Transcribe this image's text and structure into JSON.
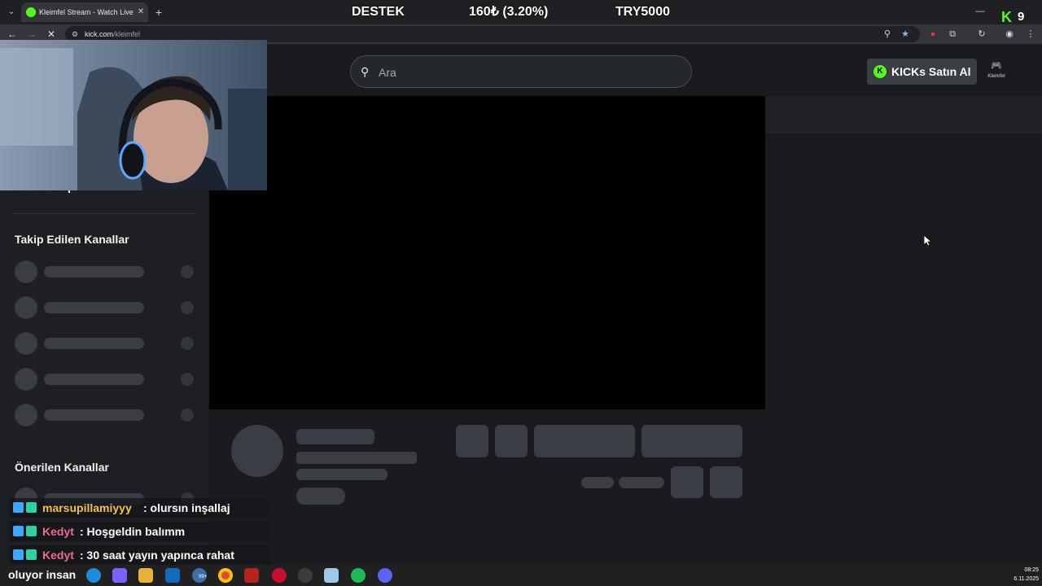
{
  "browser": {
    "tab": {
      "title": "Kleimfel Stream - Watch Live o",
      "close": "✕"
    },
    "new_tab": "+",
    "dropdown": "⌄",
    "url": {
      "host": "kick.com",
      "path": "/kleimfel"
    },
    "minimize": "—",
    "kick_badge": {
      "letter": "K",
      "count": "9"
    }
  },
  "stream_overlay": {
    "label": "DESTEK",
    "amount": "160₺ (3.20%)",
    "goal": "TRY5000"
  },
  "header": {
    "search_placeholder": "Ara",
    "kicks_button": "KICKs Satın Al",
    "profile_name": "Kleimfel"
  },
  "sidebar": {
    "hidden_heading": "Takip Edilen Kanallar",
    "followed_title": "Takip Edilen Kanallar",
    "recommended_title": "Önerilen Kanallar"
  },
  "chat": [
    {
      "user": "marsupillamiyyy",
      "text": ": olursın inşallaj",
      "color": "#f5c242"
    },
    {
      "user": "Kedyt",
      "text": ": Hoşgeldin balımm",
      "color": "#f06a8a"
    },
    {
      "user": "Kedyt",
      "text": ": 30 saat yayın yapınca rahat",
      "color": "#f06a8a"
    }
  ],
  "taskbar": {
    "overlay_text": "oluyor insan",
    "mail_badge": "99+",
    "clock_time": "08:25",
    "clock_date": "6.11.2025"
  },
  "colors": {
    "kick_green": "#53fc18",
    "background": "#191b1f"
  }
}
